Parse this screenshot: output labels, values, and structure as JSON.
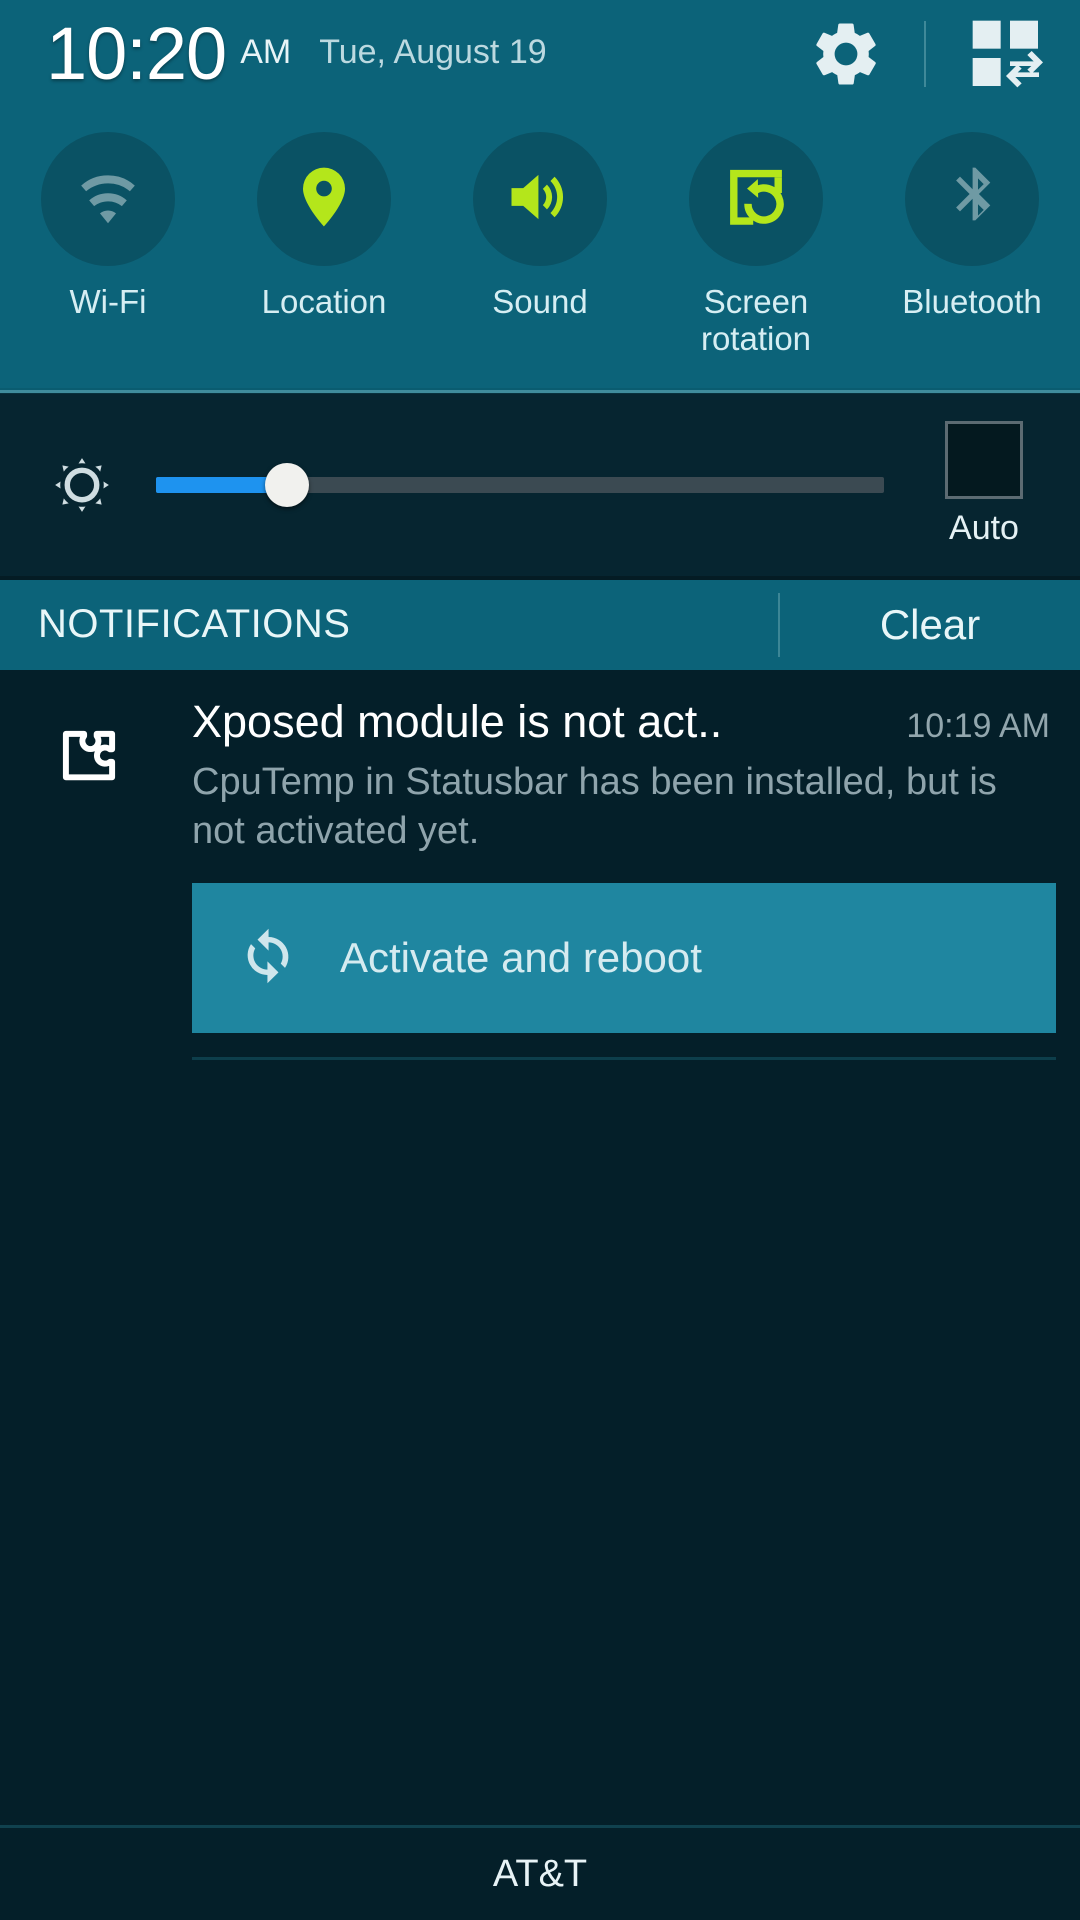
{
  "status_bar": {
    "time": "10:20",
    "ampm": "AM",
    "date": "Tue, August 19",
    "settings_icon": "gear-icon",
    "edit_icon": "quick-settings-grid-icon"
  },
  "quick_toggles": [
    {
      "label": "Wi-Fi",
      "icon": "wifi-icon",
      "state": "off",
      "color": "#6f9aa4"
    },
    {
      "label": "Location",
      "icon": "location-pin-icon",
      "state": "on",
      "color": "#b4e61b"
    },
    {
      "label": "Sound",
      "icon": "speaker-sound-icon",
      "state": "on",
      "color": "#b4e61b"
    },
    {
      "label": "Screen\nrotation",
      "icon": "screen-rotation-icon",
      "state": "on",
      "color": "#b4e61b"
    },
    {
      "label": "Bluetooth",
      "icon": "bluetooth-icon",
      "state": "off",
      "color": "#6f9aa4"
    }
  ],
  "brightness": {
    "icon": "brightness-gear-icon",
    "value_percent": 18,
    "fill_color": "#1e93ef",
    "track_color": "#3b4a52",
    "auto_label": "Auto",
    "auto_checked": false
  },
  "notifications_header": {
    "title": "NOTIFICATIONS",
    "clear_label": "Clear"
  },
  "notifications": [
    {
      "icon": "puzzle-piece-icon",
      "title": "Xposed module is not act..",
      "time": "10:19 AM",
      "text": "CpuTemp in Statusbar has been installed, but is not activated yet.",
      "action": {
        "icon": "sync-refresh-icon",
        "label": "Activate and reboot",
        "background": "#1f86a0"
      }
    }
  ],
  "carrier": {
    "name": "AT&T"
  },
  "theme": {
    "panel_teal": "#0c6379",
    "toggle_circle": "#0a5264",
    "page_background": "#041f29",
    "brightness_background": "#062530",
    "accent_green": "#b4e61b",
    "accent_blue": "#1e93ef"
  }
}
